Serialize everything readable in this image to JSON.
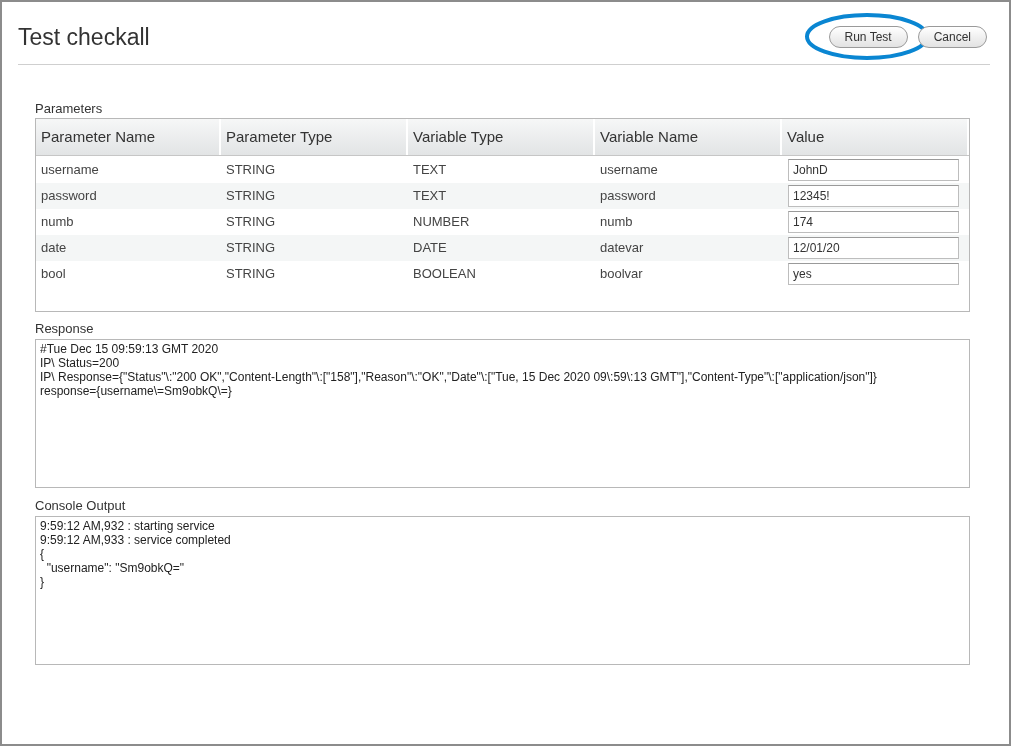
{
  "window": {
    "title": "Test checkall"
  },
  "buttons": [
    {
      "label": "Run Test",
      "highlighted": true
    },
    {
      "label": "Cancel",
      "highlighted": false
    }
  ],
  "parameters": {
    "label": "Parameters",
    "columns": [
      "Parameter Name",
      "Parameter Type",
      "Variable Type",
      "Variable Name",
      "Value"
    ],
    "rows": [
      {
        "cells": [
          "username",
          "STRING",
          "TEXT",
          "username"
        ],
        "value": "JohnD"
      },
      {
        "cells": [
          "password",
          "STRING",
          "TEXT",
          "password"
        ],
        "value": "12345!"
      },
      {
        "cells": [
          "numb",
          "STRING",
          "NUMBER",
          "numb"
        ],
        "value": "174"
      },
      {
        "cells": [
          "date",
          "STRING",
          "DATE",
          "datevar"
        ],
        "value": "12/01/20"
      },
      {
        "cells": [
          "bool",
          "STRING",
          "BOOLEAN",
          "boolvar"
        ],
        "value": "yes"
      }
    ]
  },
  "response": {
    "label": "Response",
    "lines": [
      "#Tue Dec 15 09:59:13 GMT 2020",
      "IP\\ Status=200",
      "IP\\ Response={\"Status\"\\:\"200 OK\",\"Content-Length\"\\:[\"158\"],\"Reason\"\\:\"OK\",\"Date\"\\:[\"Tue, 15 Dec 2020 09\\:59\\:13 GMT\"],\"Content-Type\"\\:[\"application/json\"]}",
      "response={username\\=Sm9obkQ\\=}"
    ]
  },
  "console_output": {
    "label": "Console Output",
    "lines": [
      "9:59:12 AM,932 : starting service",
      "9:59:12 AM,933 : service completed",
      "{",
      "  \"username\": \"Sm9obkQ=\"",
      "}"
    ]
  }
}
